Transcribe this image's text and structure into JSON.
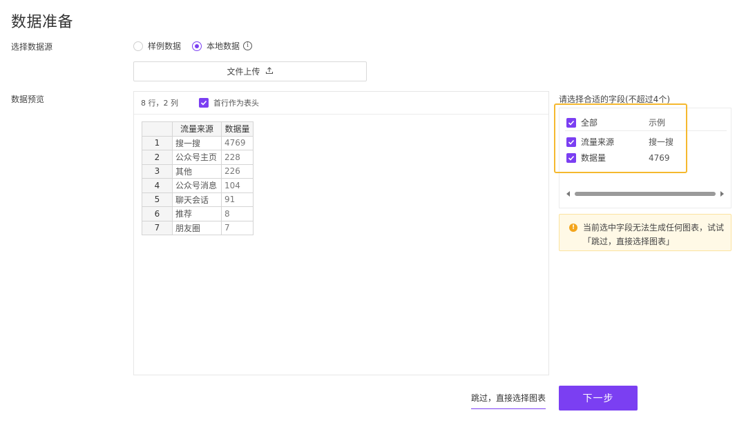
{
  "page": {
    "title": "数据准备"
  },
  "source": {
    "label": "选择数据源",
    "options": [
      {
        "label": "样例数据",
        "checked": false
      },
      {
        "label": "本地数据",
        "checked": true
      }
    ],
    "info_icon": "i",
    "upload_label": "文件上传",
    "upload_icon": "⤒"
  },
  "preview": {
    "label": "数据预览",
    "rowcol": "8 行，2 列",
    "header_checkbox_label": "首行作为表头",
    "table": {
      "headers": [
        "流量来源",
        "数据量"
      ],
      "rows": [
        {
          "idx": "1",
          "src": "搜一搜",
          "cnt": "4769"
        },
        {
          "idx": "2",
          "src": "公众号主页",
          "cnt": "228"
        },
        {
          "idx": "3",
          "src": "其他",
          "cnt": "226"
        },
        {
          "idx": "4",
          "src": "公众号消息",
          "cnt": "104"
        },
        {
          "idx": "5",
          "src": "聊天会话",
          "cnt": "91"
        },
        {
          "idx": "6",
          "src": "推荐",
          "cnt": "8"
        },
        {
          "idx": "7",
          "src": "朋友圈",
          "cnt": "7"
        }
      ]
    }
  },
  "fields": {
    "title": "请选择合适的字段(不超过4个)",
    "all_label": "全部",
    "example_label": "示例",
    "items": [
      {
        "name": "流量来源",
        "example": "搜一搜"
      },
      {
        "name": "数据量",
        "example": "4769"
      }
    ]
  },
  "warning": {
    "icon": "!",
    "text": "当前选中字段无法生成任何图表，试试「跳过，直接选择图表」"
  },
  "actions": {
    "skip_label": "跳过，直接选择图表",
    "next_label": "下一步"
  },
  "colors": {
    "accent": "#7b3ff2",
    "highlight": "#f5b82e",
    "warning_bg": "#fff9e6"
  }
}
